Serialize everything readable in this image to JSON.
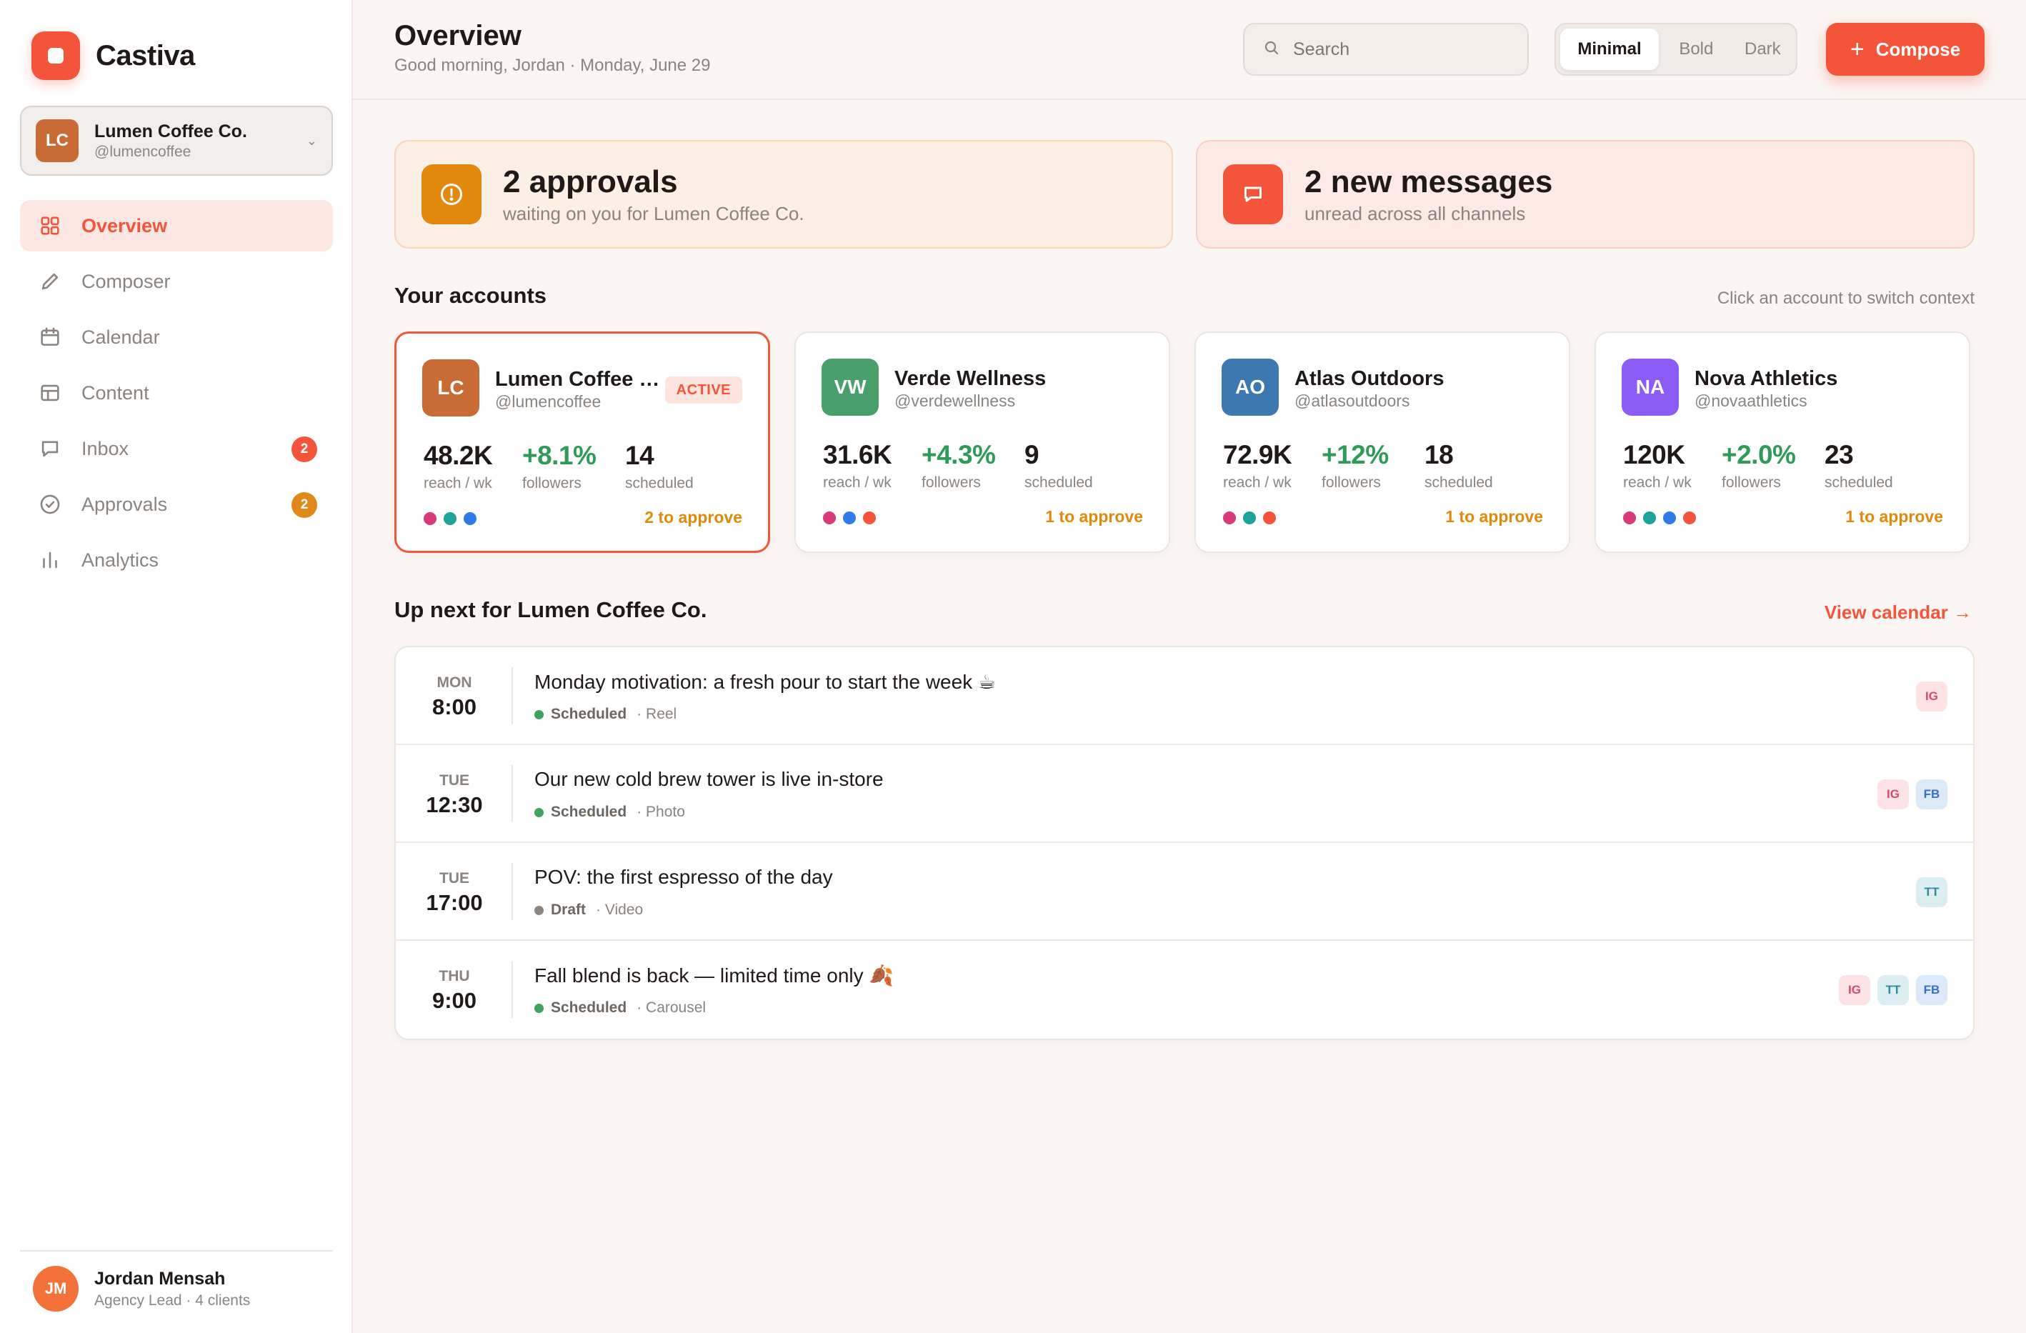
{
  "brand": {
    "name": "Castiva",
    "color": "#f4553a"
  },
  "account_switcher": {
    "initials": "LC",
    "name": "Lumen Coffee Co.",
    "handle": "@lumencoffee",
    "color": "#c96b35"
  },
  "nav": [
    {
      "label": "Overview",
      "icon": "grid-icon",
      "active": true
    },
    {
      "label": "Composer",
      "icon": "pencil-icon"
    },
    {
      "label": "Calendar",
      "icon": "calendar-icon"
    },
    {
      "label": "Content",
      "icon": "layout-icon"
    },
    {
      "label": "Inbox",
      "icon": "chat-icon",
      "badge": "2",
      "badge_color": "#f4553a"
    },
    {
      "label": "Approvals",
      "icon": "check-circle-icon",
      "badge": "2",
      "badge_color": "#e0891a"
    },
    {
      "label": "Analytics",
      "icon": "bar-chart-icon"
    }
  ],
  "user": {
    "initials": "JM",
    "name": "Jordan Mensah",
    "role": "Agency Lead · 4 clients"
  },
  "header": {
    "title": "Overview",
    "subtitle": "Good morning, Jordan · Monday, June 29",
    "search_placeholder": "Search",
    "themes": [
      "Minimal",
      "Bold",
      "Dark"
    ],
    "active_theme": "Minimal",
    "compose_label": "Compose"
  },
  "alerts": [
    {
      "headline": "2 approvals",
      "sub": "waiting on you for Lumen Coffee Co.",
      "icon": "alert-circle-icon"
    },
    {
      "headline": "2 new messages",
      "sub": "unread across all channels",
      "icon": "message-icon"
    }
  ],
  "accounts_section": {
    "title": "Your accounts",
    "note": "Click an account to switch context"
  },
  "accounts": [
    {
      "initials": "LC",
      "name": "Lumen Coffee Co.",
      "handle": "@lumencoffee",
      "color": "#c96b35",
      "active_label": "ACTIVE",
      "reach": "48.2K",
      "reach_label": "reach / wk",
      "followers": "+8.1%",
      "followers_label": "followers",
      "scheduled": "14",
      "scheduled_label": "scheduled",
      "channels": [
        "#d93a7a",
        "#1ea39a",
        "#2f7be8"
      ],
      "approve": "2 to approve"
    },
    {
      "initials": "VW",
      "name": "Verde Wellness",
      "handle": "@verdewellness",
      "color": "#4aa06a",
      "reach": "31.6K",
      "reach_label": "reach / wk",
      "followers": "+4.3%",
      "followers_label": "followers",
      "scheduled": "9",
      "scheduled_label": "scheduled",
      "channels": [
        "#d93a7a",
        "#2f7be8",
        "#f4553a"
      ],
      "approve": "1 to approve"
    },
    {
      "initials": "AO",
      "name": "Atlas Outdoors",
      "handle": "@atlasoutdoors",
      "color": "#3d78b0",
      "reach": "72.9K",
      "reach_label": "reach / wk",
      "followers": "+12%",
      "followers_label": "followers",
      "scheduled": "18",
      "scheduled_label": "scheduled",
      "channels": [
        "#d93a7a",
        "#1ea39a",
        "#f4553a"
      ],
      "approve": "1 to approve"
    },
    {
      "initials": "NA",
      "name": "Nova Athletics",
      "handle": "@novaathletics",
      "color": "#8b5cf6",
      "reach": "120K",
      "reach_label": "reach / wk",
      "followers": "+2.0%",
      "followers_label": "followers",
      "scheduled": "23",
      "scheduled_label": "scheduled",
      "channels": [
        "#d93a7a",
        "#1ea39a",
        "#2f7be8",
        "#f4553a"
      ],
      "approve": "1 to approve"
    }
  ],
  "upnext": {
    "title": "Up next for Lumen Coffee Co.",
    "link": "View calendar →"
  },
  "posts": [
    {
      "day": "MON",
      "time": "8:00",
      "title": "Monday motivation: a fresh pour to start the week ☕",
      "status": "Scheduled",
      "status_color": "#3fa35f",
      "type": "· Reel",
      "channels": [
        "IG"
      ]
    },
    {
      "day": "TUE",
      "time": "12:30",
      "title": "Our new cold brew tower is live in-store",
      "status": "Scheduled",
      "status_color": "#3fa35f",
      "type": "· Photo",
      "channels": [
        "IG",
        "FB"
      ]
    },
    {
      "day": "TUE",
      "time": "17:00",
      "title": "POV: the first espresso of the day",
      "status": "Draft",
      "status_color": "#8a837e",
      "type": "· Video",
      "channels": [
        "TT"
      ]
    },
    {
      "day": "THU",
      "time": "9:00",
      "title": "Fall blend is back — limited time only 🍂",
      "status": "Scheduled",
      "status_color": "#3fa35f",
      "type": "· Carousel",
      "channels": [
        "IG",
        "TT",
        "FB"
      ]
    }
  ]
}
